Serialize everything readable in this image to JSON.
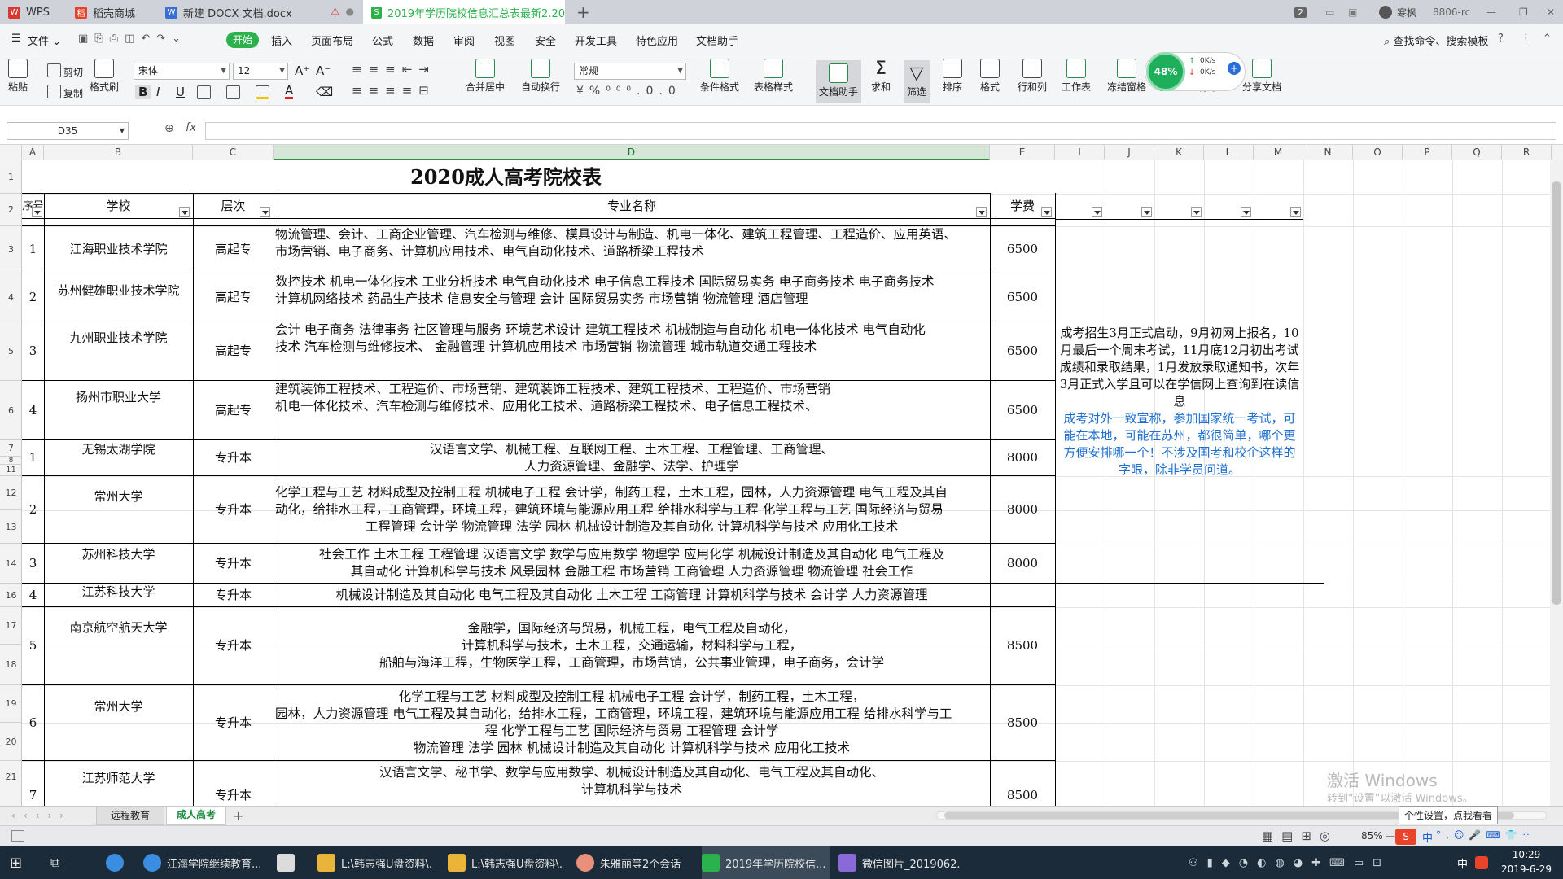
{
  "tabs": [
    {
      "label": "WPS",
      "color": "#d8392c"
    },
    {
      "label": "稻壳商城",
      "color": "#e8412a"
    },
    {
      "label": "新建 DOCX 文档.docx",
      "color": "#3a6fd8"
    },
    {
      "label": "2019年学历院校信息汇总表最新2.20",
      "color": "#2bb24c"
    }
  ],
  "titlebar_right": {
    "badge": "2",
    "user": "寒枫",
    "uid": "8806-rc"
  },
  "menu": {
    "file": "文件",
    "start": "开始",
    "items": [
      "插入",
      "页面布局",
      "公式",
      "数据",
      "审阅",
      "视图",
      "安全",
      "开发工具",
      "特色应用",
      "文档助手"
    ],
    "search": "查找命令、搜索模板"
  },
  "toolbar": {
    "paste": "粘贴",
    "cut": "剪切",
    "copy": "复制",
    "format_painter": "格式刷",
    "font": "宋体",
    "size": "12",
    "bold": "B",
    "italic": "I",
    "underline": "U",
    "merge": "合并居中",
    "wrap": "自动换行",
    "numfmt": "常规",
    "cond": "条件格式",
    "table": "表格样式",
    "assist": "文档助手",
    "sum": "求和",
    "filter": "筛选",
    "sort": "排序",
    "format": "格式",
    "rowcol": "行和列",
    "sheet": "工作表",
    "freeze": "冻结窗格",
    "find": "查找",
    "symbol": "符号",
    "share": "分享文档",
    "pct": "48%",
    "net_up": "0K/s",
    "net_down": "0K/s"
  },
  "namebox": "D35",
  "sheet": {
    "cols": [
      "A",
      "B",
      "C",
      "D",
      "E",
      "I",
      "J",
      "K",
      "L",
      "M",
      "N",
      "O",
      "P",
      "Q",
      "R"
    ],
    "title": "2020成人高考院校表",
    "headers": {
      "no": "序号",
      "school": "学校",
      "level": "层次",
      "major": "专业名称",
      "fee": "学费"
    },
    "row_nums": [
      "1",
      "2",
      "3",
      "4",
      "5",
      "6",
      "7",
      "8",
      "11",
      "12",
      "13",
      "14",
      "16",
      "17",
      "18",
      "19",
      "20",
      "21"
    ],
    "rows": [
      {
        "no": "1",
        "school": "江海职业技术学院",
        "level": "高起专",
        "major1": "物流管理、会计、工商企业管理、汽车检测与维修、模具设计与制造、机电一体化、建筑工程管理、工程造价、应用英语、",
        "major2": "市场营销、电子商务、计算机应用技术、电气自动化技术、道路桥梁工程技术",
        "fee": "6500"
      },
      {
        "no": "2",
        "school": "苏州健雄职业技术学院",
        "level": "高起专",
        "major1": "数控技术 机电一体化技术 工业分析技术 电气自动化技术   电子信息工程技术 国际贸易实务 电子商务技术   电子商务技术",
        "major2": "计算机网络技术   药品生产技术 信息安全与管理 会计 国际贸易实务    市场营销 物流管理 酒店管理",
        "fee": "6500"
      },
      {
        "no": "3",
        "school": "九州职业技术学院",
        "level": "高起专",
        "major1": " 会计 电子商务 法律事务 社区管理与服务 环境艺术设计 建筑工程技术 机械制造与自动化   机电一体化技术 电气自动化",
        "major2": "技术 汽车检测与维修技术、    金融管理 计算机应用技术    市场营销    物流管理    城市轨道交通工程技术",
        "fee": "6500"
      },
      {
        "no": "4",
        "school": "扬州市职业大学",
        "level": "高起专",
        "major1": "建筑装饰工程技术、工程造价、市场营销、建筑装饰工程技术、建筑工程技术、工程造价、市场营销",
        "major2": "机电一体化技术、汽车检测与维修技术、应用化工技术、道路桥梁工程技术、电子信息工程技术、",
        "fee": "6500"
      },
      {
        "no": "1",
        "school": "无锡太湖学院",
        "level": "专升本",
        "major1": "汉语言文学、机械工程、互联网工程、土木工程、工程管理、工商管理、",
        "major2": "人力资源管理、金融学、法学、护理学",
        "fee": "8000"
      },
      {
        "no": "2",
        "school": "常州大学",
        "level": "专升本",
        "major1": "化学工程与工艺 材料成型及控制工程 机械电子工程 会计学，制药工程，土木工程，园林，人力资源管理   电气工程及其自",
        "major2": "动化，给排水工程，工商管理，环境工程，建筑环境与能源应用工程 给排水科学与工程   化学工程与工艺 国际经济与贸易",
        "major3": "工程管理    会计学 物流管理 法学 园林 机械设计制造及其自动化   计算机科学与技术 应用化工技术",
        "fee": "8000"
      },
      {
        "no": "3",
        "school": "苏州科技大学",
        "level": "专升本",
        "major1": "社会工作   土木工程 工程管理     汉语言文学   数学与应用数学   物理学 应用化学   机械设计制造及其自动化 电气工程及",
        "major2": "其自动化   计算机科学与技术   风景园林 金融工程   市场营销    工商管理   人力资源管理 物流管理 社会工作",
        "fee": "8000"
      },
      {
        "no": "4",
        "school": "江苏科技大学",
        "level": "专升本",
        "major1": "机械设计制造及其自动化    电气工程及其自动化 土木工程 工商管理 计算机科学与技术 会计学 人力资源管理",
        "fee": ""
      },
      {
        "no": "5",
        "school": "南京航空航天大学",
        "level": "专升本",
        "major1": "金融学，国际经济与贸易，机械工程，电气工程及自动化，",
        "major2": "计算机科学与技术，土木工程，交通运输，材料科学与工程，",
        "major3": "船舶与海洋工程，生物医学工程，工商管理，市场营销，公共事业管理，电子商务，会计学",
        "fee": "8500"
      },
      {
        "no": "6",
        "school": "常州大学",
        "level": "专升本",
        "major1": "化学工程与工艺 材料成型及控制工程 机械电子工程 会计学，制药工程，土木工程，",
        "major2": "园林，人力资源管理   电气工程及其自动化，给排水工程，工商管理，环境工程，建筑环境与能源应用工程 给排水科学与工",
        "major3": "程   化学工程与工艺 国际经济与贸易    工程管理    会计学",
        "major4": "物流管理 法学 园林 机械设计制造及其自动化   计算机科学与技术 应用化工技术",
        "fee": "8500"
      },
      {
        "no": "7",
        "school": "江苏师范大学",
        "level": "专升本",
        "major1": "汉语言文学、秘书学、数学与应用数学、机械设计制造及其自动化、电气工程及其自动化、",
        "major2": "计算机科学与技术",
        "fee": "8500"
      }
    ],
    "note_black": "成考招生3月正式启动，9月初网上报名，10月最后一个周末考试，11月底12月初出考试成绩和录取结果，1月发放录取通知书，次年3月正式入学且可以在学信网上查询到在读信息",
    "note_blue": "成考对外一致宣称，参加国家统一考试，可能在本地，可能在苏州，都很简单，哪个更方便安排哪一个！不涉及国考和校企这样的字眼，除非学员问道。",
    "note_blue_color": "#1f6fd0",
    "activate1": "激活 Windows",
    "activate2": "转到“设置”以激活 Windows。"
  },
  "sheet_tabs": [
    "远程教育",
    "成人高考"
  ],
  "status": {
    "zoom": "85%",
    "tooltip": "个性设置，点我看看",
    "ime": "中"
  },
  "taskbar": {
    "items": [
      {
        "label": "江海学院继续教育...",
        "color": "#3a8de0"
      },
      {
        "label": "",
        "color": "#dcdcdc"
      },
      {
        "label": "L:\\韩志强U盘资料\\...",
        "color": "#e8b43a"
      },
      {
        "label": "L:\\韩志强U盘资料\\...",
        "color": "#e8b43a"
      },
      {
        "label": "朱雅丽等2个会话",
        "color": "#e8907a"
      },
      {
        "label": "2019年学历院校信...",
        "color": "#2bb24c"
      },
      {
        "label": "微信图片_2019062...",
        "color": "#8a6ad8"
      }
    ],
    "ime": "中",
    "time": "10:29",
    "date": "2019-6-29"
  }
}
